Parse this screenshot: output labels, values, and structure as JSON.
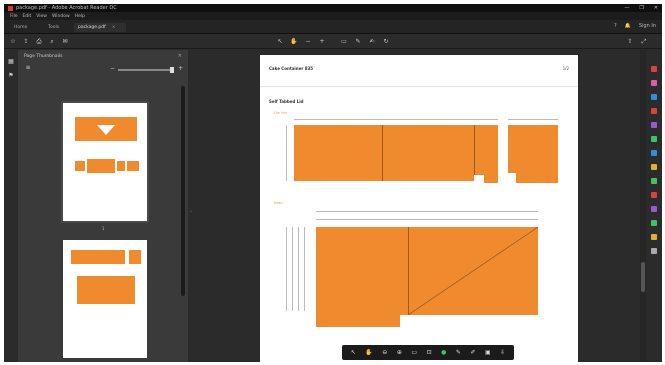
{
  "window": {
    "title": "package.pdf - Adobe Acrobat Reader DC",
    "controls": [
      "—",
      "❐",
      "✕"
    ]
  },
  "menu": [
    "File",
    "Edit",
    "View",
    "Window",
    "Help"
  ],
  "tabs": {
    "home": "Home",
    "tools": "Tools",
    "document": "package.pdf",
    "close": "×"
  },
  "account": {
    "help": "?",
    "bell": "🔔",
    "signin": "Sign In"
  },
  "thumbnails": {
    "panel_title": "Page Thumbnails",
    "close": "×",
    "zoom_minus": "−",
    "zoom_plus": "+",
    "page_numbers": [
      "1",
      "2"
    ]
  },
  "page": {
    "header_left": "Cake Container 835",
    "header_right": "1/2",
    "section_title": "Self Tabbed Lid",
    "caption_1": "Die line",
    "caption_2": "Base"
  },
  "colors": {
    "accent": "#ef8a2f",
    "bg": "#2b2b2b",
    "panel": "#3a3a3a",
    "active": "#3fc16a"
  },
  "icons": [
    "home-icon",
    "star-icon",
    "print-icon",
    "search-icon",
    "cursor-icon",
    "hand-icon",
    "zoom-out-icon",
    "zoom-in-icon",
    "fit-icon",
    "comment-icon",
    "pen-icon",
    "share-icon"
  ]
}
